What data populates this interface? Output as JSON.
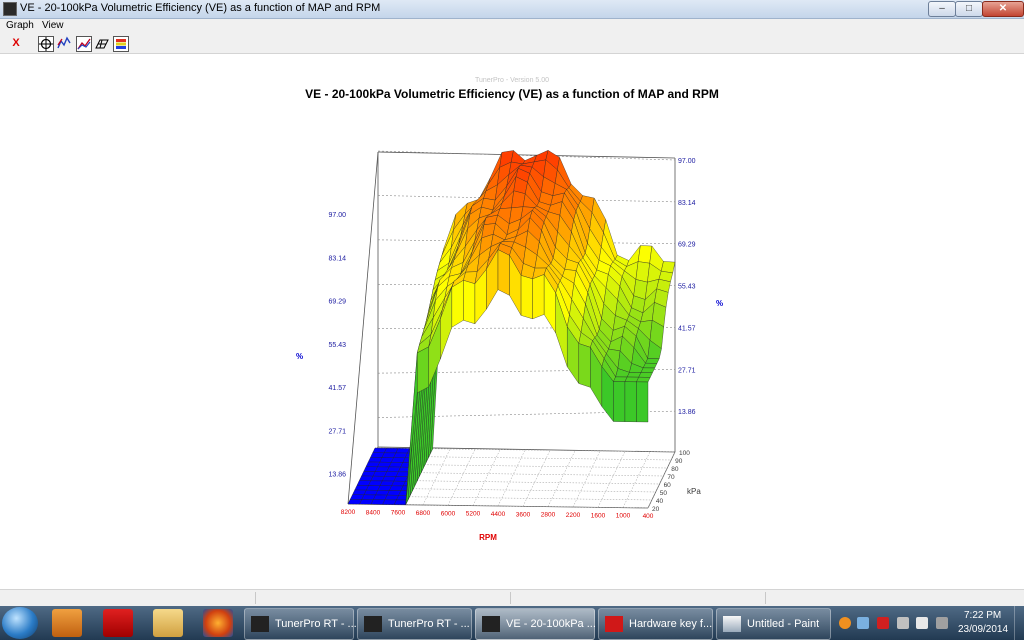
{
  "window": {
    "title": "VE - 20-100kPa Volumetric Efficiency (VE) as a function of MAP and RPM",
    "min": "–",
    "max": "□",
    "close": "✕"
  },
  "menu": [
    "Graph",
    "View"
  ],
  "toolbar": {
    "close_glyph": "X"
  },
  "graph": {
    "watermark": "TunerPro - Version 5.00",
    "title": "VE - 20-100kPa Volumetric Efficiency (VE) as a function of MAP and RPM"
  },
  "chart_data": {
    "type": "surface3d",
    "title": "VE - 20-100kPa Volumetric Efficiency (VE) as a function of MAP and RPM",
    "x_label": "RPM",
    "x_ticks": [
      "8200",
      "8400",
      "7600",
      "6800",
      "6000",
      "5200",
      "4400",
      "3600",
      "2800",
      "2200",
      "1600",
      "1000",
      "400"
    ],
    "y_label": "kPa",
    "y_ticks": [
      "20",
      "40",
      "50",
      "60",
      "70",
      "80",
      "90",
      "100"
    ],
    "z_label": "%",
    "z_ticks": [
      "13.86",
      "27.71",
      "41.57",
      "55.43",
      "69.29",
      "83.14",
      "97.00"
    ],
    "z_range": [
      0,
      97
    ],
    "colors": {
      "low": "#0000ff",
      "mid": "#ffff00",
      "high": "#ff3300"
    }
  },
  "taskbar": {
    "items": [
      {
        "label": "TunerPro RT - ...",
        "active": false
      },
      {
        "label": "TunerPro RT - ...",
        "active": false
      },
      {
        "label": "VE - 20-100kPa ...",
        "active": true
      },
      {
        "label": "Hardware key f...",
        "active": false
      },
      {
        "label": "Untitled - Paint",
        "active": false
      }
    ],
    "time": "7:22 PM",
    "date": "23/09/2014"
  }
}
